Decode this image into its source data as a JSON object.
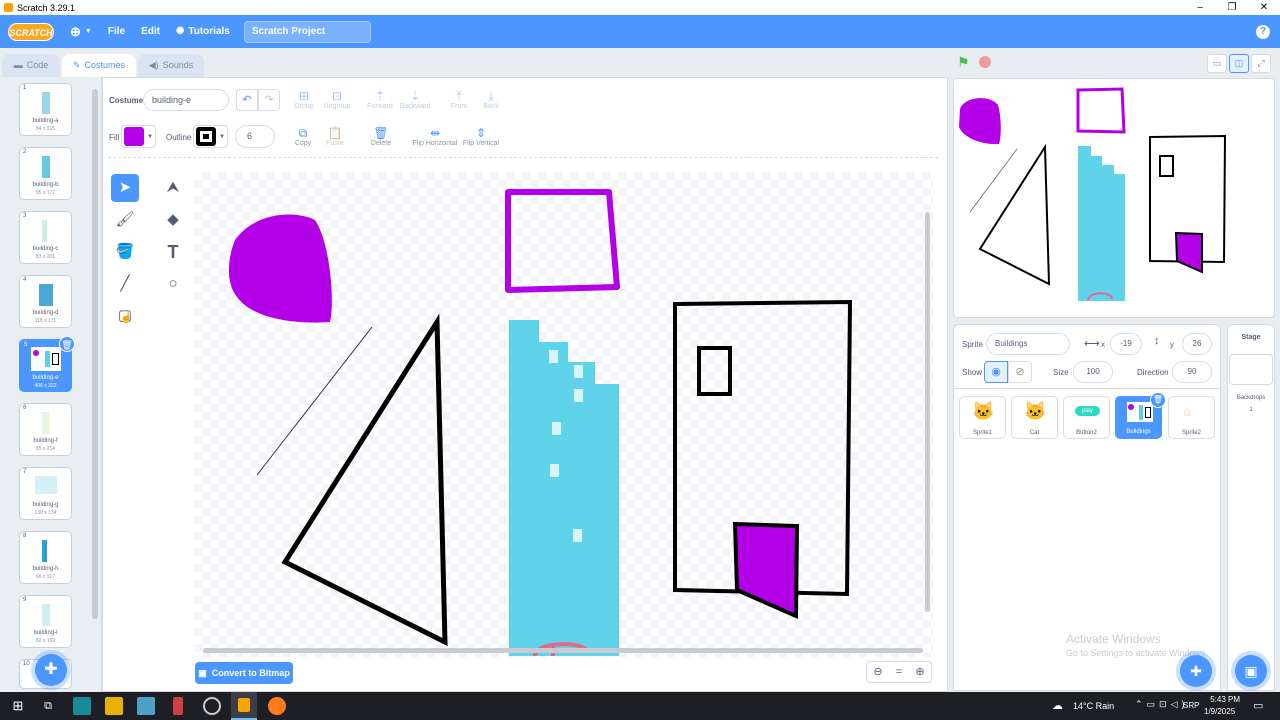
{
  "window": {
    "title": "Scratch 3.29.1",
    "controls": [
      "–",
      "❐",
      "✕"
    ]
  },
  "menu": {
    "logo": "SCRATCH",
    "file": "File",
    "edit": "Edit",
    "tutorials": "Tutorials",
    "project_title": "Scratch Project",
    "help": "?"
  },
  "tabs": {
    "code": "Code",
    "costumes": "Costumes",
    "sounds": "Sounds"
  },
  "costumes": [
    {
      "num": "1",
      "name": "building-a",
      "size": "84 x 215"
    },
    {
      "num": "2",
      "name": "building-b",
      "size": "95 x 172"
    },
    {
      "num": "3",
      "name": "building-c",
      "size": "83 x 201"
    },
    {
      "num": "4",
      "name": "building-d",
      "size": "118 x 171"
    },
    {
      "num": "5",
      "name": "building-e",
      "size": "406 x 322"
    },
    {
      "num": "6",
      "name": "building-f",
      "size": "85 x 214"
    },
    {
      "num": "7",
      "name": "building-g",
      "size": "130 x 134"
    },
    {
      "num": "8",
      "name": "building-h",
      "size": "66 x 317"
    },
    {
      "num": "9",
      "name": "building-i",
      "size": "82 x 169"
    },
    {
      "num": "10",
      "name": "",
      "size": ""
    }
  ],
  "editor": {
    "costume_label": "Costume",
    "costume_name": "building-e",
    "fill_label": "Fill",
    "outline_label": "Outline",
    "outline_width": "6",
    "fill_color": "#b300e6",
    "outline_color": "#000000",
    "buttons": {
      "group": "Group",
      "ungroup": "Ungroup",
      "forward": "Forward",
      "backward": "Backward",
      "front": "Front",
      "back": "Back",
      "copy": "Copy",
      "paste": "Paste",
      "delete": "Delete",
      "flip_h": "Flip Horizontal",
      "flip_v": "Flip Vertical"
    },
    "convert": "Convert to Bitmap",
    "zoom_reset": "="
  },
  "sprite_info": {
    "sprite_label": "Sprite",
    "sprite_name": "Buildings",
    "x_label": "x",
    "x": "-19",
    "y_label": "y",
    "y": "26",
    "show_label": "Show",
    "size_label": "Size",
    "size": "100",
    "direction_label": "Direction",
    "direction": "90"
  },
  "sprites": [
    "Sprite1",
    "Cat",
    "Button2",
    "Buildings",
    "Sprite2"
  ],
  "sprite_button_text": "play",
  "stage_panel": {
    "title": "Stage",
    "backdrops_label": "Backdrops",
    "backdrops_count": "1"
  },
  "watermark": {
    "line1": "Activate Windows",
    "line2": "Go to Settings to activate Windows."
  },
  "taskbar": {
    "weather": "14°C  Rain",
    "lang": "SRP",
    "time": "5:43 PM",
    "date": "1/9/2025"
  }
}
